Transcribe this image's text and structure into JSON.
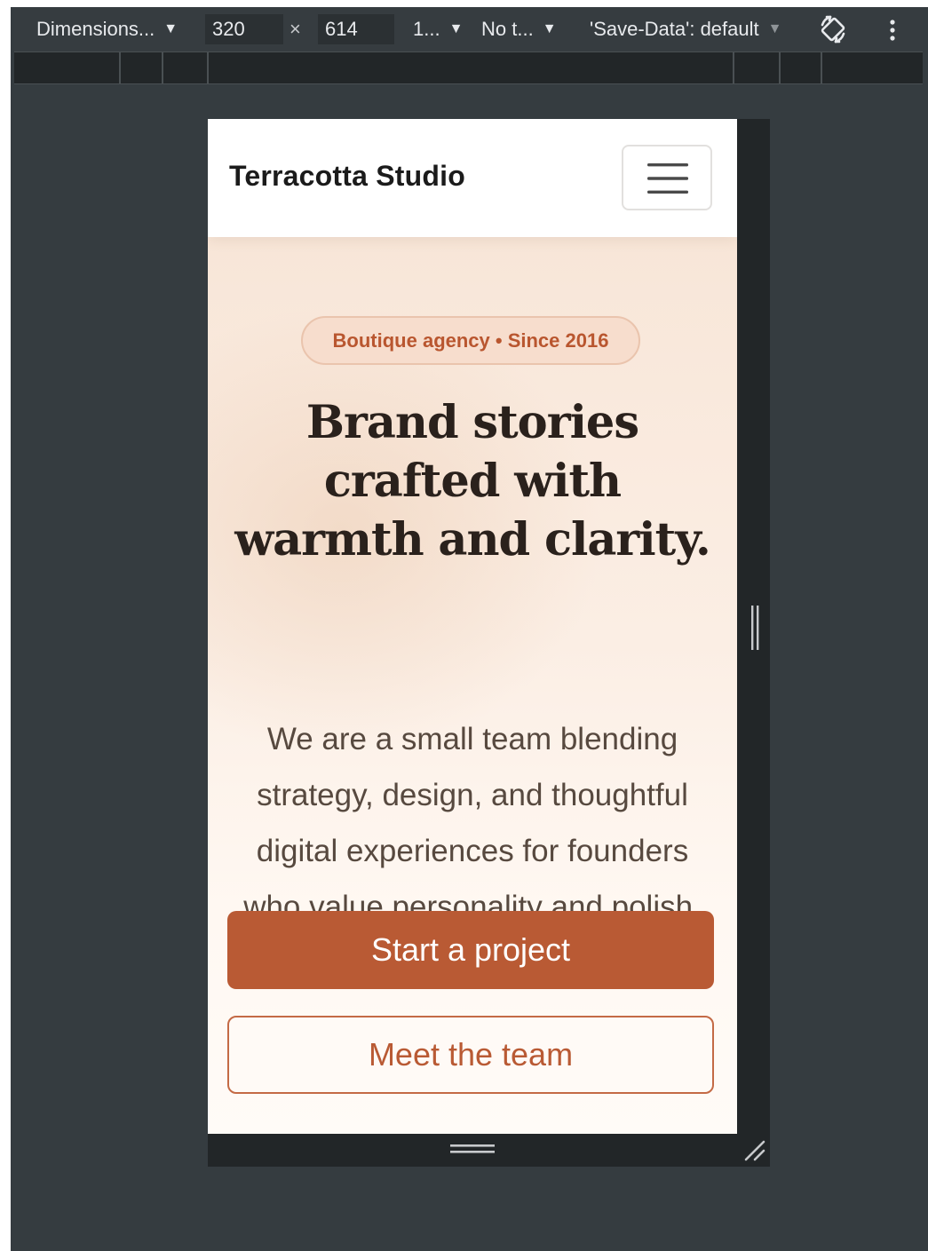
{
  "toolbar": {
    "dimensions_label": "Dimensions...",
    "width_value": "320",
    "times_symbol": "×",
    "height_value": "614",
    "zoom_label": "1...",
    "throttling_label": "No t...",
    "save_data_label": "'Save-Data': default",
    "dropdown_arrow": "▼"
  },
  "site": {
    "brand_name": "Terracotta Studio",
    "badge": "Boutique agency • Since 2016",
    "headline": "Brand stories crafted with warmth and clarity.",
    "description": "We are a small team blending strategy, design, and thoughtful digital experiences for founders who value personality and polish.",
    "primary_cta": "Start a project",
    "secondary_cta": "Meet the team"
  },
  "colors": {
    "accent": "#b95a34",
    "devtools_bg": "#353c40",
    "hero_bg": "#f8e6d8",
    "heading": "#2a211c",
    "body_text": "#57493f"
  },
  "icons": {
    "menu": "hamburger-icon",
    "rotate": "rotate-device-icon",
    "more": "more-vert-icon"
  }
}
